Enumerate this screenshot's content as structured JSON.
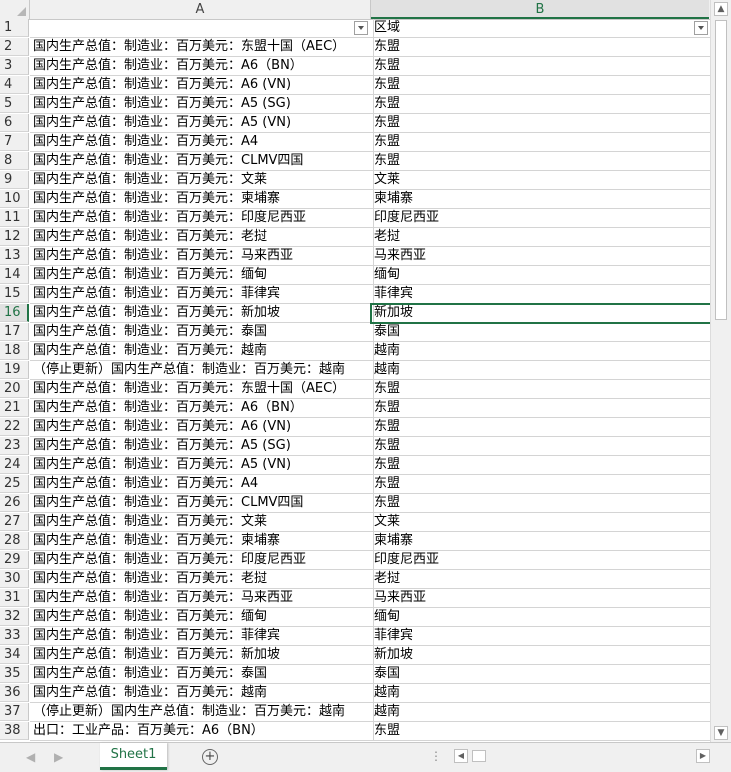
{
  "columns": {
    "a": "A",
    "b": "B"
  },
  "active_row": "16",
  "rows": [
    {
      "n": "1",
      "a": "",
      "b": "区域"
    },
    {
      "n": "2",
      "a": "国内生产总值：制造业：百万美元：东盟十国（AEC）",
      "b": "东盟"
    },
    {
      "n": "3",
      "a": "国内生产总值：制造业：百万美元：A6（BN）",
      "b": "东盟"
    },
    {
      "n": "4",
      "a": "国内生产总值：制造业：百万美元：A6 (VN)",
      "b": "东盟"
    },
    {
      "n": "5",
      "a": "国内生产总值：制造业：百万美元：A5 (SG)",
      "b": "东盟"
    },
    {
      "n": "6",
      "a": "国内生产总值：制造业：百万美元：A5 (VN)",
      "b": "东盟"
    },
    {
      "n": "7",
      "a": "国内生产总值：制造业：百万美元：A4",
      "b": "东盟"
    },
    {
      "n": "8",
      "a": "国内生产总值：制造业：百万美元：CLMV四国",
      "b": "东盟"
    },
    {
      "n": "9",
      "a": "国内生产总值：制造业：百万美元：文莱",
      "b": "文莱"
    },
    {
      "n": "10",
      "a": "国内生产总值：制造业：百万美元：柬埔寨",
      "b": "柬埔寨"
    },
    {
      "n": "11",
      "a": "国内生产总值：制造业：百万美元：印度尼西亚",
      "b": "印度尼西亚"
    },
    {
      "n": "12",
      "a": "国内生产总值：制造业：百万美元：老挝",
      "b": "老挝"
    },
    {
      "n": "13",
      "a": "国内生产总值：制造业：百万美元：马来西亚",
      "b": "马来西亚"
    },
    {
      "n": "14",
      "a": "国内生产总值：制造业：百万美元：缅甸",
      "b": "缅甸"
    },
    {
      "n": "15",
      "a": "国内生产总值：制造业：百万美元：菲律宾",
      "b": "菲律宾"
    },
    {
      "n": "16",
      "a": "国内生产总值：制造业：百万美元：新加坡",
      "b": "新加坡"
    },
    {
      "n": "17",
      "a": "国内生产总值：制造业：百万美元：泰国",
      "b": "泰国"
    },
    {
      "n": "18",
      "a": "国内生产总值：制造业：百万美元：越南",
      "b": "越南"
    },
    {
      "n": "19",
      "a": "（停止更新）国内生产总值：制造业：百万美元：越南",
      "b": "越南"
    },
    {
      "n": "20",
      "a": "国内生产总值：制造业：百万美元：东盟十国（AEC）",
      "b": "东盟"
    },
    {
      "n": "21",
      "a": "国内生产总值：制造业：百万美元：A6（BN）",
      "b": "东盟"
    },
    {
      "n": "22",
      "a": "国内生产总值：制造业：百万美元：A6 (VN)",
      "b": "东盟"
    },
    {
      "n": "23",
      "a": "国内生产总值：制造业：百万美元：A5 (SG)",
      "b": "东盟"
    },
    {
      "n": "24",
      "a": "国内生产总值：制造业：百万美元：A5 (VN)",
      "b": "东盟"
    },
    {
      "n": "25",
      "a": "国内生产总值：制造业：百万美元：A4",
      "b": "东盟"
    },
    {
      "n": "26",
      "a": "国内生产总值：制造业：百万美元：CLMV四国",
      "b": "东盟"
    },
    {
      "n": "27",
      "a": "国内生产总值：制造业：百万美元：文莱",
      "b": "文莱"
    },
    {
      "n": "28",
      "a": "国内生产总值：制造业：百万美元：柬埔寨",
      "b": "柬埔寨"
    },
    {
      "n": "29",
      "a": "国内生产总值：制造业：百万美元：印度尼西亚",
      "b": "印度尼西亚"
    },
    {
      "n": "30",
      "a": "国内生产总值：制造业：百万美元：老挝",
      "b": "老挝"
    },
    {
      "n": "31",
      "a": "国内生产总值：制造业：百万美元：马来西亚",
      "b": "马来西亚"
    },
    {
      "n": "32",
      "a": "国内生产总值：制造业：百万美元：缅甸",
      "b": "缅甸"
    },
    {
      "n": "33",
      "a": "国内生产总值：制造业：百万美元：菲律宾",
      "b": "菲律宾"
    },
    {
      "n": "34",
      "a": "国内生产总值：制造业：百万美元：新加坡",
      "b": "新加坡"
    },
    {
      "n": "35",
      "a": "国内生产总值：制造业：百万美元：泰国",
      "b": "泰国"
    },
    {
      "n": "36",
      "a": "国内生产总值：制造业：百万美元：越南",
      "b": "越南"
    },
    {
      "n": "37",
      "a": "（停止更新）国内生产总值：制造业：百万美元：越南",
      "b": "越南"
    },
    {
      "n": "38",
      "a": "出口：工业产品：百万美元：A6（BN）",
      "b": "东盟"
    }
  ],
  "sheet_tab": "Sheet1",
  "add_sheet_glyph": "+",
  "dots_glyph": "⋮",
  "icons": {
    "nav_prev": "◀",
    "nav_next": "▶",
    "scroll_up": "▲",
    "scroll_down": "▼",
    "scroll_left": "◀",
    "scroll_right": "▶"
  },
  "colors": {
    "accent": "#217346",
    "header_bg": "#f0f0f0",
    "grid_line": "#d4d4d4"
  }
}
